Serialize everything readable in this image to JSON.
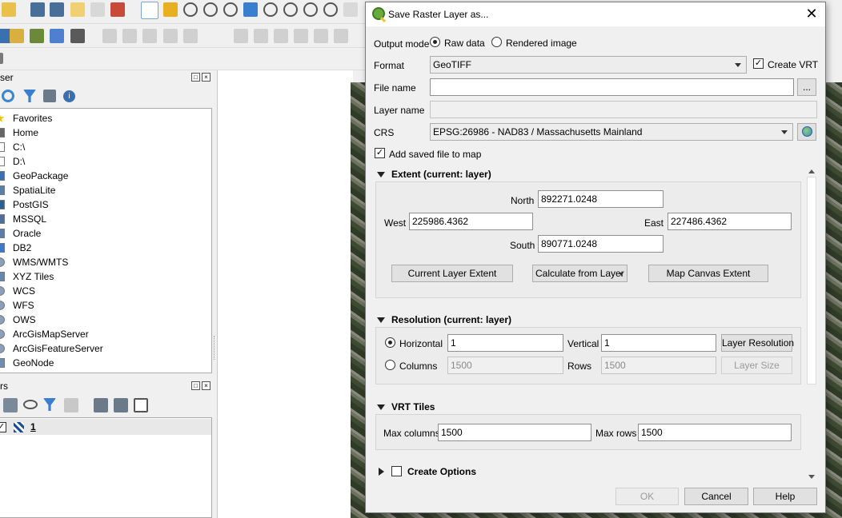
{
  "background": {
    "browser_panel": {
      "title": "ser",
      "items": [
        {
          "label": "Favorites",
          "icon": "star-icon",
          "color": "#f2c200"
        },
        {
          "label": "Home",
          "icon": "home-icon",
          "color": "#666666"
        },
        {
          "label": "C:\\",
          "icon": "folder-icon",
          "color": "#ffffff"
        },
        {
          "label": "D:\\",
          "icon": "folder-icon",
          "color": "#ffffff"
        },
        {
          "label": "GeoPackage",
          "icon": "geopackage-icon",
          "color": "#3a6fb0"
        },
        {
          "label": "SpatiaLite",
          "icon": "spatialite-icon",
          "color": "#5a7fa8"
        },
        {
          "label": "PostGIS",
          "icon": "postgis-icon",
          "color": "#2f5f8f"
        },
        {
          "label": "MSSQL",
          "icon": "mssql-icon",
          "color": "#4f6f9a"
        },
        {
          "label": "Oracle",
          "icon": "oracle-icon",
          "color": "#5b7ea8"
        },
        {
          "label": "DB2",
          "icon": "db2-icon",
          "color": "#3f78c8"
        },
        {
          "label": "WMS/WMTS",
          "icon": "globe-icon",
          "color": "#8aa0b8"
        },
        {
          "label": "XYZ Tiles",
          "icon": "xyz-tiles-icon",
          "color": "#6688aa"
        },
        {
          "label": "WCS",
          "icon": "globe-icon",
          "color": "#8aa0b8"
        },
        {
          "label": "WFS",
          "icon": "globe-icon",
          "color": "#8aa0b8"
        },
        {
          "label": "OWS",
          "icon": "globe-icon",
          "color": "#8aa0b8"
        },
        {
          "label": "ArcGisMapServer",
          "icon": "globe-icon",
          "color": "#8aa0b8"
        },
        {
          "label": "ArcGisFeatureServer",
          "icon": "globe-icon",
          "color": "#8aa0b8"
        },
        {
          "label": "GeoNode",
          "icon": "geonode-icon",
          "color": "#6f8fb0"
        }
      ]
    },
    "layers_panel": {
      "title": "rs",
      "layer_name": "1"
    }
  },
  "dialog": {
    "title": "Save Raster Layer as...",
    "output_mode": {
      "label": "Output mode",
      "options": [
        "Raw data",
        "Rendered image"
      ],
      "selected": "Raw data"
    },
    "format": {
      "label": "Format",
      "value": "GeoTIFF"
    },
    "create_vrt": {
      "label": "Create VRT",
      "checked": true
    },
    "file_name": {
      "label": "File name",
      "value": "",
      "browse_label": "..."
    },
    "layer_name": {
      "label": "Layer name",
      "value": ""
    },
    "crs": {
      "label": "CRS",
      "value": "EPSG:26986 - NAD83 / Massachusetts Mainland"
    },
    "add_saved_file": {
      "label": "Add saved file to map",
      "checked": true
    },
    "extent": {
      "title": "Extent (current: layer)",
      "north_label": "North",
      "north": "892271.0248",
      "west_label": "West",
      "west": "225986.4362",
      "east_label": "East",
      "east": "227486.4362",
      "south_label": "South",
      "south": "890771.0248",
      "current_layer_extent": "Current Layer Extent",
      "calculate_from_layer": "Calculate from Layer",
      "map_canvas_extent": "Map Canvas Extent"
    },
    "resolution": {
      "title": "Resolution (current: layer)",
      "horizontal_label": "Horizontal",
      "horizontal": "1",
      "vertical_label": "Vertical",
      "vertical": "1",
      "layer_resolution": "Layer Resolution",
      "columns_label": "Columns",
      "columns": "1500",
      "rows_label": "Rows",
      "rows": "1500",
      "layer_size": "Layer Size",
      "selected": "Horizontal"
    },
    "vrt_tiles": {
      "title": "VRT Tiles",
      "max_columns_label": "Max columns",
      "max_columns": "1500",
      "max_rows_label": "Max rows",
      "max_rows": "1500"
    },
    "create_options": {
      "title": "Create Options",
      "checked": false
    },
    "buttons": {
      "ok": "OK",
      "cancel": "Cancel",
      "help": "Help"
    }
  }
}
